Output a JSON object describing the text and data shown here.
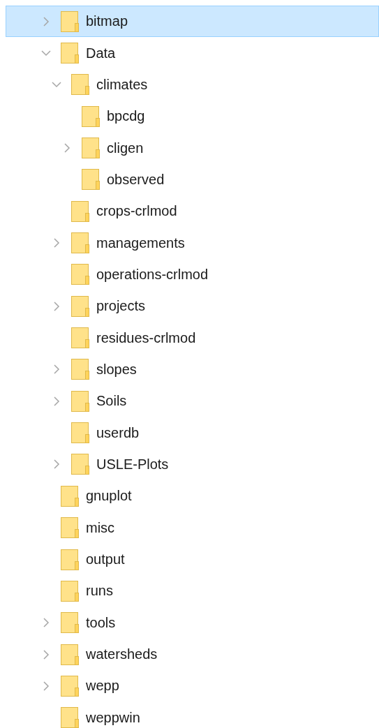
{
  "tree": [
    {
      "label": "bitmap",
      "expanded": false,
      "selected": true
    },
    {
      "label": "Data",
      "expanded": true,
      "selected": false,
      "children": [
        {
          "label": "climates",
          "expanded": true,
          "selected": false,
          "children": [
            {
              "label": "bpcdg",
              "selected": false
            },
            {
              "label": "cligen",
              "expanded": false,
              "selected": false
            },
            {
              "label": "observed",
              "selected": false
            }
          ]
        },
        {
          "label": "crops-crlmod",
          "selected": false
        },
        {
          "label": "managements",
          "expanded": false,
          "selected": false
        },
        {
          "label": "operations-crlmod",
          "selected": false
        },
        {
          "label": "projects",
          "expanded": false,
          "selected": false
        },
        {
          "label": "residues-crlmod",
          "selected": false
        },
        {
          "label": "slopes",
          "expanded": false,
          "selected": false
        },
        {
          "label": "Soils",
          "expanded": false,
          "selected": false
        },
        {
          "label": "userdb",
          "selected": false
        },
        {
          "label": "USLE-Plots",
          "expanded": false,
          "selected": false
        }
      ]
    },
    {
      "label": "gnuplot",
      "selected": false
    },
    {
      "label": "misc",
      "selected": false
    },
    {
      "label": "output",
      "selected": false
    },
    {
      "label": "runs",
      "selected": false
    },
    {
      "label": "tools",
      "expanded": false,
      "selected": false
    },
    {
      "label": "watersheds",
      "expanded": false,
      "selected": false
    },
    {
      "label": "wepp",
      "expanded": false,
      "selected": false
    },
    {
      "label": "weppwin",
      "selected": false
    }
  ]
}
